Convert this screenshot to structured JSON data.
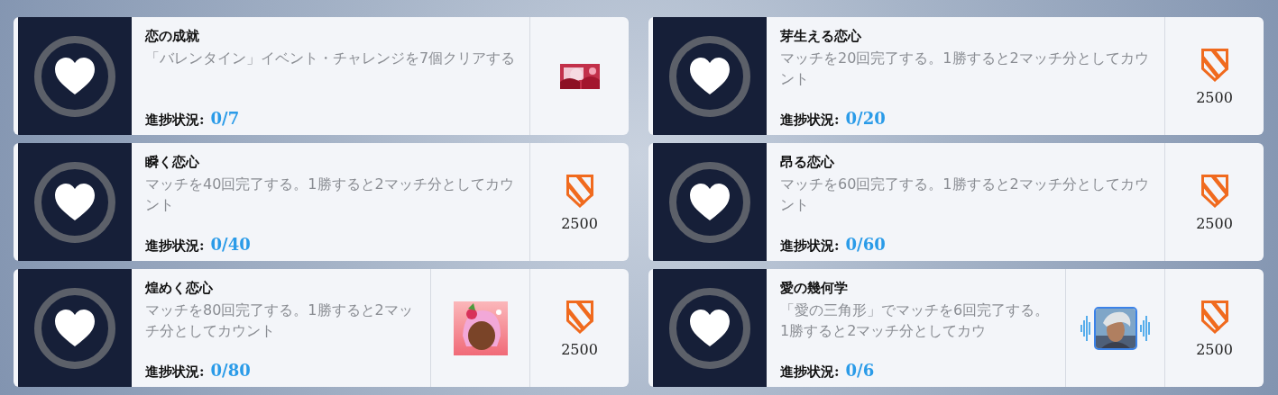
{
  "quests": [
    {
      "title": "恋の成就",
      "description": "「バレンタイン」イベント・チャレンジを7個クリアする",
      "progress_label": "進捗状況:",
      "progress": "0/7",
      "rewards": [
        {
          "kind": "banner"
        }
      ]
    },
    {
      "title": "芽生える恋心",
      "description": "マッチを20回完了する。1勝すると2マッチ分としてカウント",
      "progress_label": "進捗状況:",
      "progress": "0/20",
      "rewards": [
        {
          "kind": "currency",
          "amount": "2500"
        }
      ]
    },
    {
      "title": "瞬く恋心",
      "description": "マッチを40回完了する。1勝すると2マッチ分としてカウント",
      "progress_label": "進捗状況:",
      "progress": "0/40",
      "rewards": [
        {
          "kind": "currency",
          "amount": "2500"
        }
      ]
    },
    {
      "title": "昂る恋心",
      "description": "マッチを60回完了する。1勝すると2マッチ分としてカウント",
      "progress_label": "進捗状況:",
      "progress": "0/60",
      "rewards": [
        {
          "kind": "currency",
          "amount": "2500"
        }
      ]
    },
    {
      "title": "煌めく恋心",
      "description": "マッチを80回完了する。1勝すると2マッチ分としてカウント",
      "progress_label": "進捗状況:",
      "progress": "0/80",
      "rewards": [
        {
          "kind": "spray"
        },
        {
          "kind": "currency",
          "amount": "2500"
        }
      ]
    },
    {
      "title": "愛の幾何学",
      "description": "「愛の三角形」でマッチを6回完了する。1勝すると2マッチ分としてカウ",
      "progress_label": "進捗状況:",
      "progress": "0/6",
      "rewards": [
        {
          "kind": "voiceline"
        },
        {
          "kind": "currency",
          "amount": "2500"
        }
      ]
    }
  ]
}
